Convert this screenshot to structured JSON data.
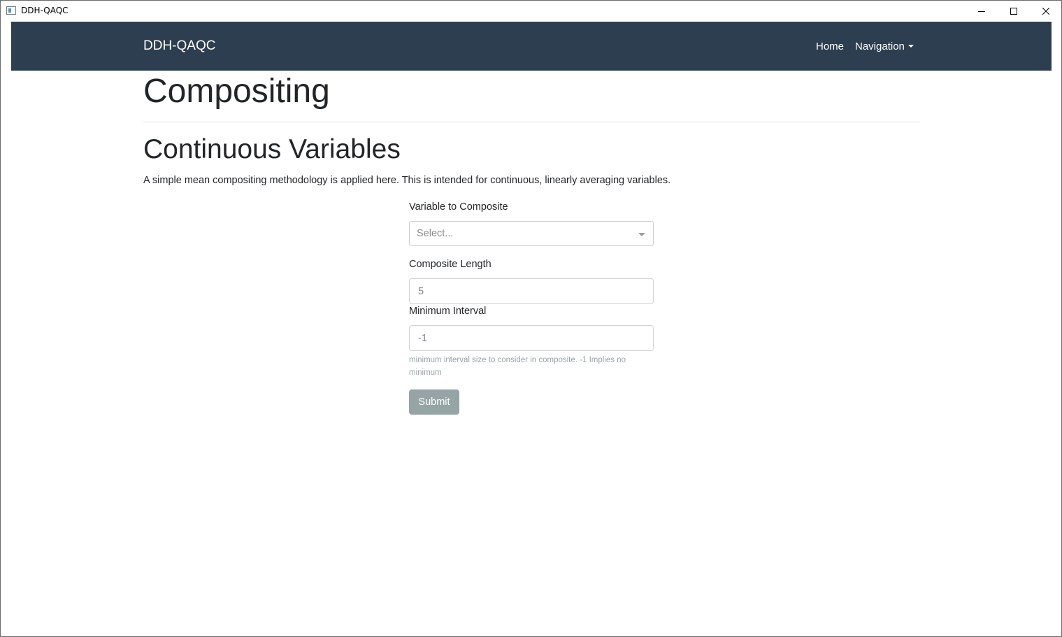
{
  "window": {
    "title": "DDH-QAQC"
  },
  "navbar": {
    "brand": "DDH-QAQC",
    "links": [
      {
        "label": "Home"
      },
      {
        "label": "Navigation",
        "icon": "caret-down-icon"
      }
    ]
  },
  "page": {
    "title": "Compositing",
    "section_title": "Continuous Variables",
    "description": "A simple mean compositing methodology is applied here. This is intended for continuous, linearly averaging variables."
  },
  "form": {
    "variable": {
      "label": "Variable to Composite",
      "placeholder": "Select..."
    },
    "composite_length": {
      "label": "Composite Length",
      "placeholder": "5"
    },
    "minimum_interval": {
      "label": "Minimum Interval",
      "placeholder": "-1",
      "help": "minimum interval size to consider in composite. -1 Implies no minimum"
    },
    "submit_label": "Submit"
  },
  "colors": {
    "navbar_bg": "#2c3e50",
    "submit_bg": "#95a5a6",
    "text": "#212529",
    "help_text": "#95a5a6"
  }
}
